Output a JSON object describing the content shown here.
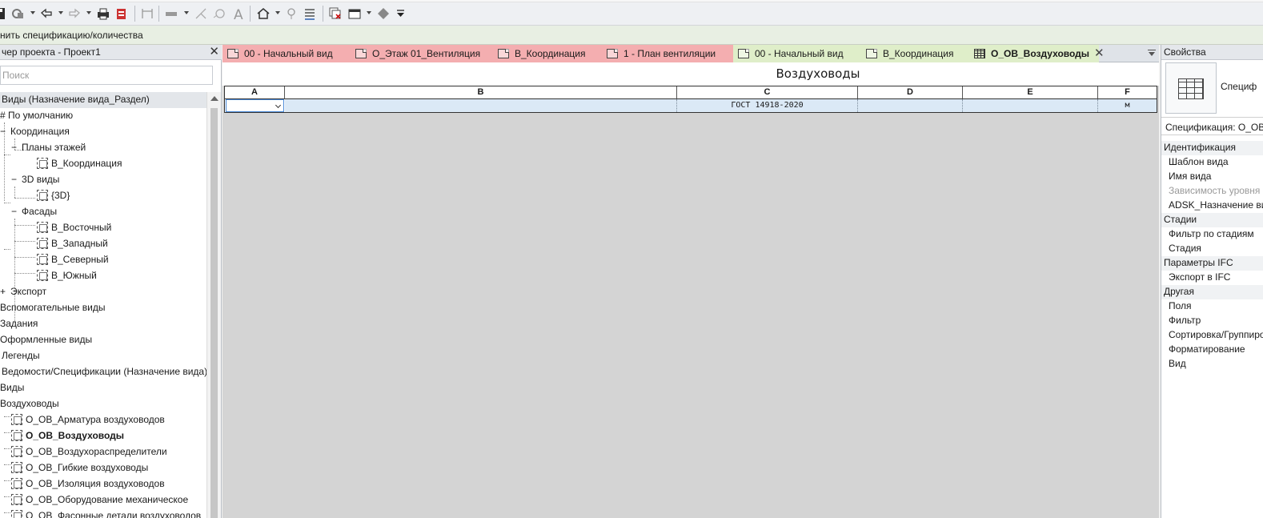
{
  "qat": {
    "icons": [
      "save-icon",
      "sync-icon",
      "undo-icon",
      "redo-icon",
      "print-icon",
      "export-icon",
      "measure-icon",
      "dimension-icon",
      "align-icon",
      "tag-icon",
      "text-icon",
      "home-view-icon",
      "section-icon",
      "thin-lines-icon",
      "close-hidden-windows-icon",
      "switch-windows-icon",
      "settings-icon"
    ]
  },
  "prompt": {
    "text": "нить спецификацию/количества"
  },
  "browser": {
    "title": "чер проекта - Проект1",
    "search_placeholder": "Поиск",
    "items": [
      {
        "label": "Виды (Назначение вида_Раздел)"
      },
      {
        "label": "# По умолчанию"
      },
      {
        "label": "Координация"
      },
      {
        "label": "Планы этажей"
      },
      {
        "label": "В_Координация"
      },
      {
        "label": "3D виды"
      },
      {
        "label": "{3D}"
      },
      {
        "label": "Фасады"
      },
      {
        "label": "В_Восточный"
      },
      {
        "label": "В_Западный"
      },
      {
        "label": "В_Северный"
      },
      {
        "label": "В_Южный"
      },
      {
        "label": "Экспорт"
      },
      {
        "label": "Вспомогательные виды"
      },
      {
        "label": "Задания"
      },
      {
        "label": "Оформленные виды"
      },
      {
        "label": "Легенды"
      },
      {
        "label": "Ведомости/Спецификации (Назначение вида)"
      },
      {
        "label": "Виды"
      },
      {
        "label": "Воздуховоды"
      },
      {
        "label": "О_ОВ_Арматура воздуховодов"
      },
      {
        "label": "О_ОВ_Воздуховоды"
      },
      {
        "label": "О_ОВ_Воздухораспределители"
      },
      {
        "label": "О_ОВ_Гибкие воздуховоды"
      },
      {
        "label": "О_ОВ_Изоляция воздуховодов"
      },
      {
        "label": "О_ОВ_Оборудование механическое"
      },
      {
        "label": "О_ОВ_Фасонные детали воздуховодов"
      }
    ]
  },
  "tabs": [
    {
      "label": "00 - Начальный вид",
      "color": "#f4aeb0"
    },
    {
      "label": "О_Этаж 01_Вентиляция",
      "color": "#f4aeb0"
    },
    {
      "label": "В_Координация",
      "color": "#f4aeb0"
    },
    {
      "label": "1 - План вентиляции",
      "color": "#f4aeb0"
    },
    {
      "label": "00 - Начальный вид",
      "color": "#dfeec9"
    },
    {
      "label": "В_Координация",
      "color": "#dfeec9"
    },
    {
      "label": "О_ОВ_Воздуховоды",
      "color": "#dfeec9"
    }
  ],
  "schedule": {
    "title": "Воздуховоды",
    "columns": [
      "A",
      "B",
      "C",
      "D",
      "E",
      "F"
    ],
    "row": [
      "",
      "",
      "ГОСТ 14918-2020",
      "",
      "",
      "м"
    ]
  },
  "properties": {
    "title": "Свойства",
    "type_name": "Специф",
    "instance": "Спецификация: О_ОВ",
    "rows": [
      {
        "label": "Идентификация",
        "kind": "cat"
      },
      {
        "label": "Шаблон вида",
        "kind": "item"
      },
      {
        "label": "Имя вида",
        "kind": "item"
      },
      {
        "label": "Зависимость уровня",
        "kind": "dim"
      },
      {
        "label": "ADSK_Назначение вида",
        "kind": "item"
      },
      {
        "label": "Стадии",
        "kind": "cat"
      },
      {
        "label": "Фильтр по стадиям",
        "kind": "item"
      },
      {
        "label": "Стадия",
        "kind": "item"
      },
      {
        "label": "Параметры IFC",
        "kind": "cat"
      },
      {
        "label": "Экспорт в IFC",
        "kind": "item"
      },
      {
        "label": "Другая",
        "kind": "cat"
      },
      {
        "label": "Поля",
        "kind": "item"
      },
      {
        "label": "Фильтр",
        "kind": "item"
      },
      {
        "label": "Сортировка/Группировка",
        "kind": "item"
      },
      {
        "label": "Форматирование",
        "kind": "item"
      },
      {
        "label": "Вид",
        "kind": "item"
      }
    ]
  }
}
